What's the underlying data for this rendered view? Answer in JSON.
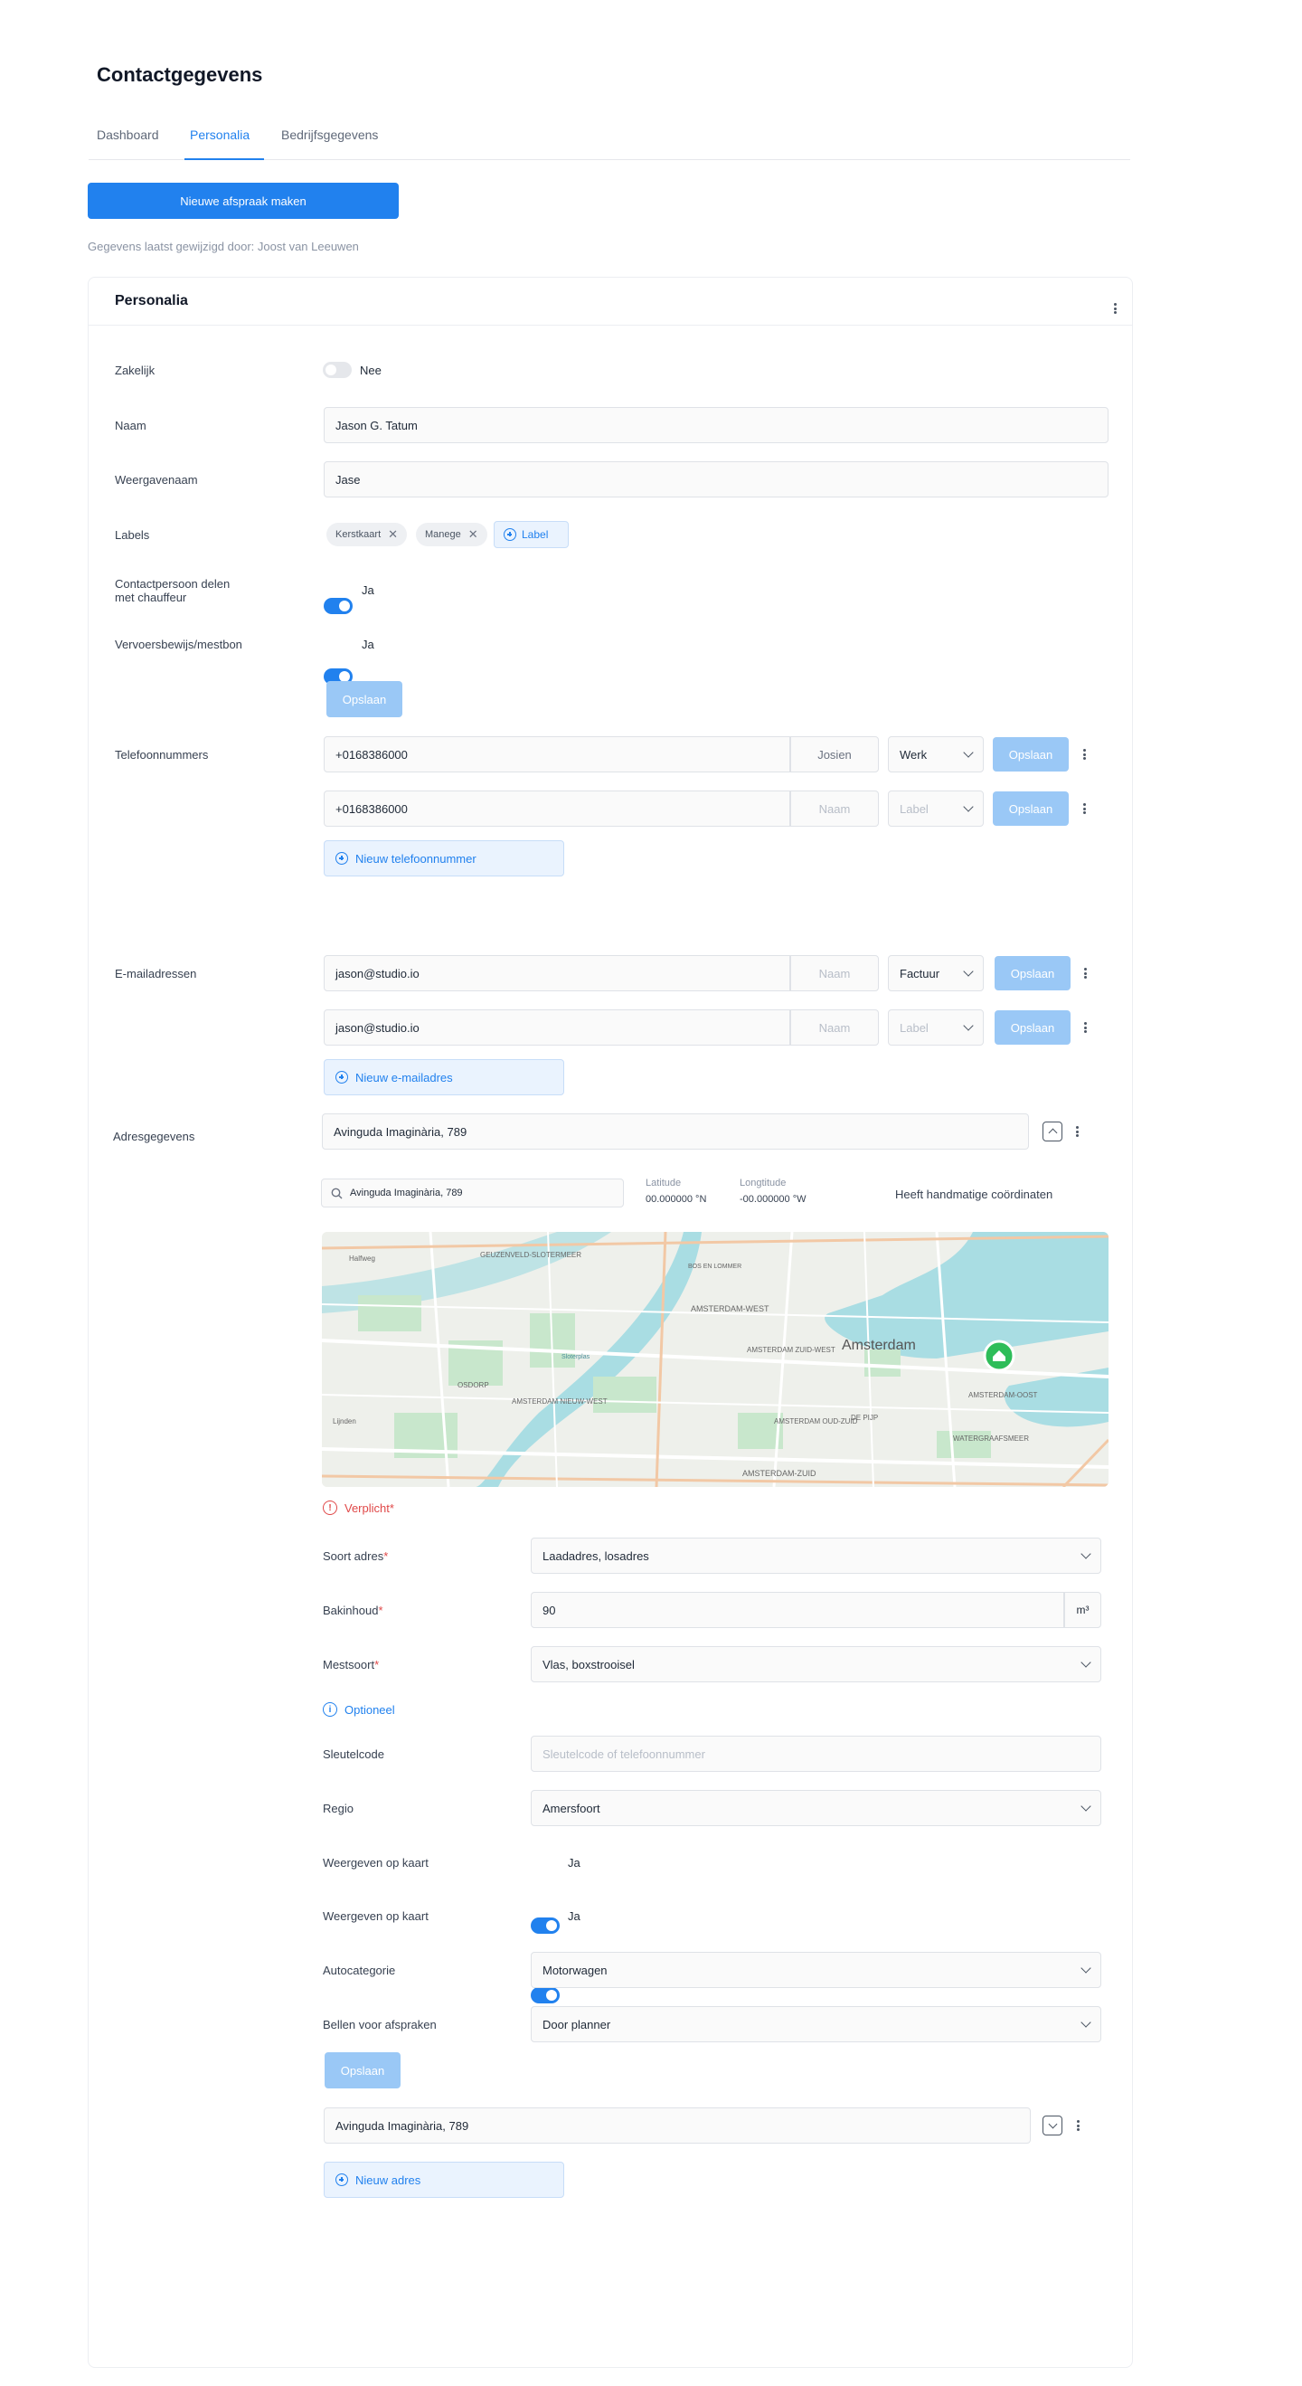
{
  "page": {
    "title": "Contactgegevens"
  },
  "tabs": [
    {
      "label": "Dashboard"
    },
    {
      "label": "Personalia"
    },
    {
      "label": "Bedrijfsgegevens"
    }
  ],
  "toolbar": {
    "new_appointment": "Nieuwe afspraak maken"
  },
  "meta": {
    "last_modified": "Gegevens laatst gewijzigd door: Joost van Leeuwen"
  },
  "card": {
    "title": "Personalia"
  },
  "fields": {
    "zakelijk": {
      "label": "Zakelijk",
      "value": "Nee",
      "on": false
    },
    "naam": {
      "label": "Naam",
      "value": "Jason G. Tatum"
    },
    "weergavenaam": {
      "label": "Weergavenaam",
      "value": "Jase"
    },
    "labels": {
      "label": "Labels",
      "chips": [
        "Kerstkaart",
        "Manege"
      ],
      "add": "Label"
    },
    "contact_delen": {
      "label_line1": "Contactpersoon delen",
      "label_line2": "met chauffeur",
      "value": "Ja",
      "on": true
    },
    "vervoersbewijs": {
      "label": "Vervoersbewijs/mestbon",
      "value": "Ja",
      "on": true
    },
    "save": "Opslaan"
  },
  "phones": {
    "label": "Telefoonnummers",
    "rows": [
      {
        "number": "+0168386000",
        "name": "Josien",
        "name_ph": "Naam",
        "type": "Werk",
        "type_ph": "Label",
        "save": "Opslaan"
      },
      {
        "number": "+0168386000",
        "name": "",
        "name_ph": "Naam",
        "type": "",
        "type_ph": "Label",
        "save": "Opslaan"
      }
    ],
    "add": "Nieuw telefoonnummer"
  },
  "emails": {
    "label": "E-mailadressen",
    "rows": [
      {
        "email": "jason@studio.io",
        "name": "",
        "name_ph": "Naam",
        "type": "Factuur",
        "type_ph": "Label",
        "save": "Opslaan"
      },
      {
        "email": "jason@studio.io",
        "name": "",
        "name_ph": "Naam",
        "type": "",
        "type_ph": "Label",
        "save": "Opslaan"
      }
    ],
    "add": "Nieuw e-mailadres"
  },
  "address": {
    "label": "Adresgegevens",
    "value": "Avinguda Imaginària, 789",
    "search": "Avinguda Imaginària, 789",
    "latitude_label": "Latitude",
    "latitude": "00.000000 °N",
    "longitude_label": "Longtitude",
    "longitude": "-00.000000 °W",
    "manual_coords": "Heeft handmatige coördinaten",
    "manual_on": false,
    "map": {
      "city": "Amsterdam",
      "districts": [
        "AMSTERDAM-WEST",
        "AMSTERDAM ZUID-WEST",
        "AMSTERDAM NIEUW-WEST",
        "AMSTERDAM OUD-ZUID",
        "AMSTERDAM-OOST",
        "AMSTERDAM-ZUID",
        "WATERGRAAFSMEER",
        "DE PIJP",
        "GEUZENVELD-SLOTERMEER",
        "BOS EN LOMMER",
        "OSDORP",
        "Halfweg",
        "Lijnden",
        "Sloterplas"
      ]
    },
    "required_text": "Verplicht",
    "soort_label": "Soort adres",
    "soort_value": "Laadadres, losadres",
    "bakinhoud_label": "Bakinhoud",
    "bakinhoud_value": "90",
    "bakinhoud_unit": "m³",
    "mestsoort_label": "Mestsoort",
    "mestsoort_value": "Vlas, boxstrooisel",
    "optional_text": "Optioneel",
    "sleutel_label": "Sleutelcode",
    "sleutel_ph": "Sleutelcode of telefoonnummer",
    "regio_label": "Regio",
    "regio_value": "Amersfoort",
    "kaart1_label": "Weergeven op kaart",
    "kaart1_value": "Ja",
    "kaart2_label": "Weergeven op kaart",
    "kaart2_value": "Ja",
    "autocat_label": "Autocategorie",
    "autocat_value": "Motorwagen",
    "bellen_label": "Bellen voor afspraken",
    "bellen_value": "Door planner",
    "save": "Opslaan",
    "second_value": "Avinguda Imaginària, 789",
    "add": "Nieuw adres"
  },
  "colors": {
    "accent": "#2181ee",
    "save_disabled": "#9ac8f6",
    "error": "#e04848",
    "pin": "#2ebd59"
  }
}
